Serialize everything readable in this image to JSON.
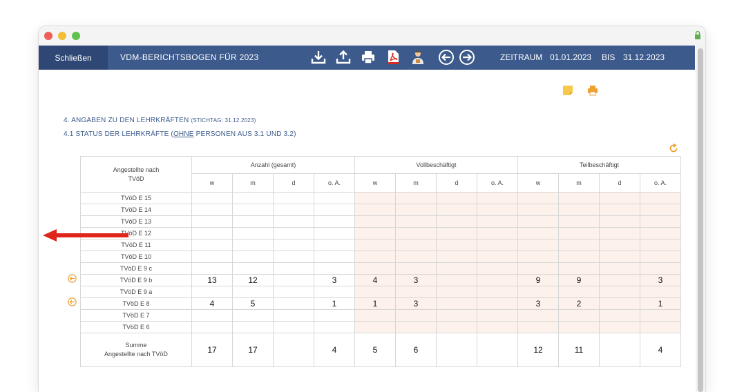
{
  "toolbar": {
    "close_label": "Schließen",
    "title": "VDM-BERICHTSBOGEN FÜR 2023",
    "zeitraum_label": "ZEITRAUM",
    "date_from": "01.01.2023",
    "bis_label": "BIS",
    "date_to": "31.12.2023"
  },
  "section": {
    "heading_main": "4. ANGABEN ZU DEN LEHRKRÄFTEN",
    "heading_note": "(STICHTAG: 31.12.2023)",
    "sub_prefix": "4.1 STATUS DER LEHRKRÄFTE (",
    "sub_underlined": "OHNE",
    "sub_suffix": " PERSONEN AUS 3.1 UND 3.2)"
  },
  "table": {
    "row_header": "Angestellte nach TVöD",
    "groups": [
      "Anzahl (gesamt)",
      "Vollbeschäftigt",
      "Teilbeschäftigt"
    ],
    "subheaders": [
      "w",
      "m",
      "d",
      "o. A.",
      "w",
      "m",
      "d",
      "o. A.",
      "w",
      "m",
      "d",
      "o. A."
    ],
    "rows": [
      {
        "label": "TVöD E 15",
        "values": [
          "",
          "",
          "",
          "",
          "",
          "",
          "",
          "",
          "",
          "",
          "",
          ""
        ]
      },
      {
        "label": "TVöD E 14",
        "values": [
          "",
          "",
          "",
          "",
          "",
          "",
          "",
          "",
          "",
          "",
          "",
          ""
        ]
      },
      {
        "label": "TVöD E 13",
        "values": [
          "",
          "",
          "",
          "",
          "",
          "",
          "",
          "",
          "",
          "",
          "",
          ""
        ]
      },
      {
        "label": "TVöD E 12",
        "values": [
          "",
          "",
          "",
          "",
          "",
          "",
          "",
          "",
          "",
          "",
          "",
          ""
        ]
      },
      {
        "label": "TVöD E 11",
        "values": [
          "",
          "",
          "",
          "",
          "",
          "",
          "",
          "",
          "",
          "",
          "",
          ""
        ]
      },
      {
        "label": "TVöD E 10",
        "values": [
          "",
          "",
          "",
          "",
          "",
          "",
          "",
          "",
          "",
          "",
          "",
          ""
        ]
      },
      {
        "label": "TVöD E 9 c",
        "values": [
          "",
          "",
          "",
          "",
          "",
          "",
          "",
          "",
          "",
          "",
          "",
          ""
        ]
      },
      {
        "label": "TVöD E 9 b",
        "values": [
          "13",
          "12",
          "",
          "3",
          "4",
          "3",
          "",
          "",
          "9",
          "9",
          "",
          "3"
        ]
      },
      {
        "label": "TVöD E 9 a",
        "values": [
          "",
          "",
          "",
          "",
          "",
          "",
          "",
          "",
          "",
          "",
          "",
          ""
        ]
      },
      {
        "label": "TVöD E 8",
        "values": [
          "4",
          "5",
          "",
          "1",
          "1",
          "3",
          "",
          "",
          "3",
          "2",
          "",
          "1"
        ]
      },
      {
        "label": "TVöD E 7",
        "values": [
          "",
          "",
          "",
          "",
          "",
          "",
          "",
          "",
          "",
          "",
          "",
          ""
        ]
      },
      {
        "label": "TVöD E 6",
        "values": [
          "",
          "",
          "",
          "",
          "",
          "",
          "",
          "",
          "",
          "",
          "",
          ""
        ]
      }
    ],
    "sum_label_1": "Summe",
    "sum_label_2": "Angestellte nach TVöD",
    "sum_values": [
      "17",
      "17",
      "",
      "4",
      "5",
      "6",
      "",
      "",
      "12",
      "11",
      "",
      "4"
    ]
  },
  "colors": {
    "toolbar_bg": "#3c5a8c",
    "close_bg": "#2f4774",
    "heading_text": "#3b5a8c",
    "accent_orange": "#f0a030",
    "shade": "#fdf1eb",
    "arrow_red": "#e0251b"
  },
  "icons": [
    "download-icon",
    "upload-icon",
    "print-icon",
    "pdf-icon",
    "person-icon",
    "arrow-left-circle-icon",
    "arrow-right-circle-icon",
    "note-icon",
    "print-icon",
    "refresh-icon",
    "row-back-icon"
  ]
}
